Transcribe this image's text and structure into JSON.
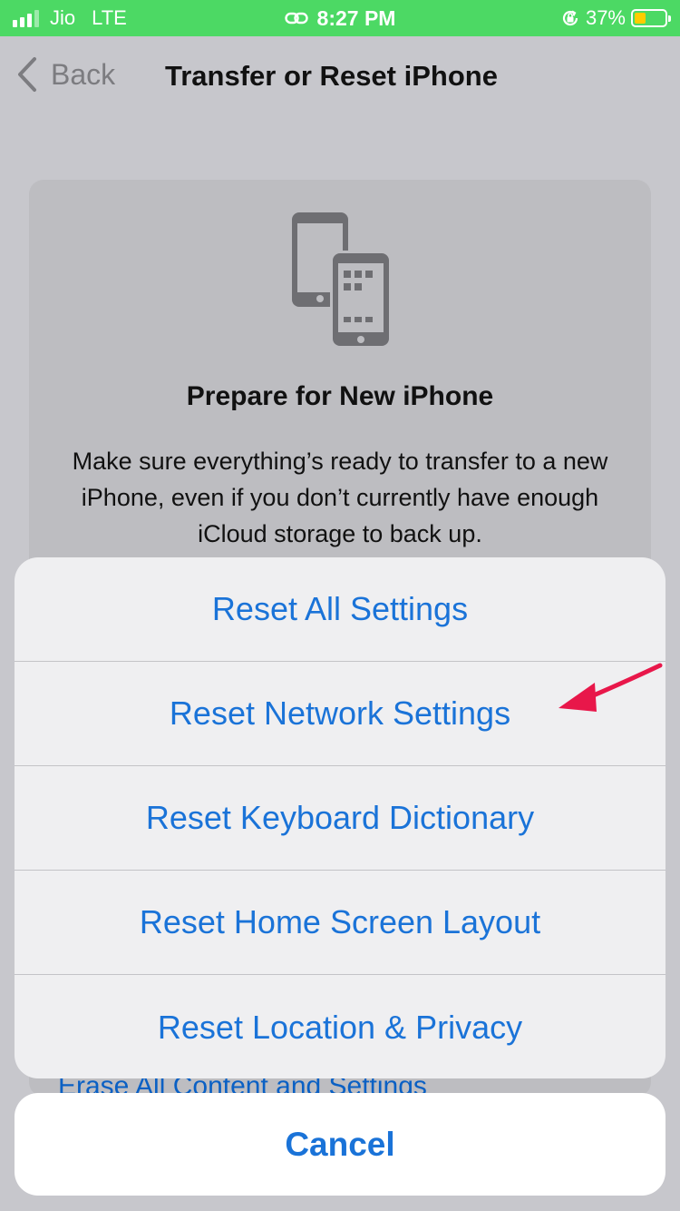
{
  "status_bar": {
    "carrier": "Jio",
    "network": "LTE",
    "time": "8:27 PM",
    "battery_percent": "37%",
    "battery_level": 0.37,
    "icons": [
      "signal-bars-icon",
      "link-icon",
      "orientation-lock-icon",
      "battery-icon"
    ]
  },
  "nav": {
    "back_label": "Back",
    "title": "Transfer or Reset iPhone"
  },
  "card": {
    "title": "Prepare for New iPhone",
    "description": "Make sure everything’s ready to transfer to a new iPhone, even if you don’t currently have enough iCloud storage to back up.",
    "erase_link": "Erase All Content and Settings"
  },
  "action_sheet": {
    "items": [
      {
        "label": "Reset All Settings"
      },
      {
        "label": "Reset Network Settings"
      },
      {
        "label": "Reset Keyboard Dictionary"
      },
      {
        "label": "Reset Home Screen Layout"
      },
      {
        "label": "Reset Location & Privacy"
      }
    ],
    "cancel_label": "Cancel"
  },
  "colors": {
    "status_bar_green": "#4cd964",
    "action_blue": "#1a73d8",
    "annotation_arrow": "#e8174a",
    "battery_yellow": "#ffcc00"
  }
}
